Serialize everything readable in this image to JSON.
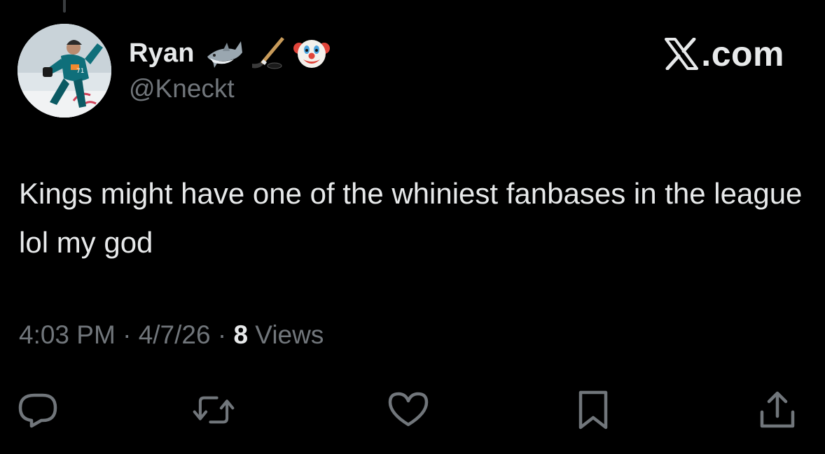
{
  "author": {
    "display_name": "Ryan",
    "handle": "@Kneckt",
    "name_emojis": [
      "shark-emoji",
      "hockey-stick-emoji",
      "clown-face-emoji"
    ]
  },
  "brand": {
    "domain": ".com"
  },
  "tweet": {
    "text": "Kings might have one of the whiniest fanbases in the league lol my god"
  },
  "meta": {
    "time": "4:03 PM",
    "separator_1": " · ",
    "date": "4/7/26",
    "separator_2": " · ",
    "views_count": "8",
    "views_label": " Views"
  },
  "actions": [
    "reply-icon",
    "retweet-icon",
    "like-icon",
    "bookmark-icon",
    "share-icon"
  ],
  "colors": {
    "background": "#000000",
    "primary_text": "#e7e9ea",
    "secondary_text": "#71767b"
  }
}
